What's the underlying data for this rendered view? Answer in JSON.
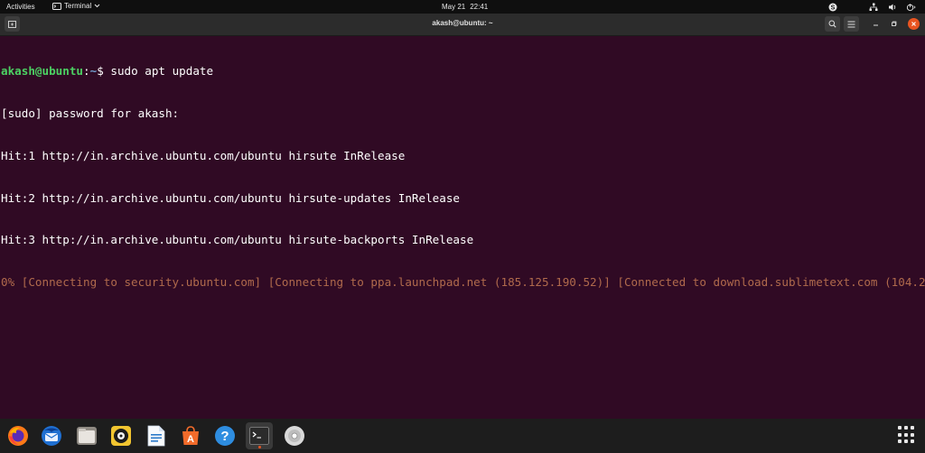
{
  "topbar": {
    "activities": "Activities",
    "app_menu": "Terminal",
    "date": "May 21",
    "time": "22:41"
  },
  "window": {
    "title": "akash@ubuntu: ~"
  },
  "terminal": {
    "prompt_user": "akash@ubuntu",
    "prompt_sep": ":",
    "prompt_path": "~",
    "prompt_dollar": "$ ",
    "command": "sudo apt update",
    "lines": [
      "[sudo] password for akash:",
      "Hit:1 http://in.archive.ubuntu.com/ubuntu hirsute InRelease",
      "Hit:2 http://in.archive.ubuntu.com/ubuntu hirsute-updates InRelease",
      "Hit:3 http://in.archive.ubuntu.com/ubuntu hirsute-backports InRelease"
    ],
    "progress_line": "0% [Connecting to security.ubuntu.com] [Connecting to ppa.launchpad.net (185.125.190.52)] [Connected to download.sublimetext.com (104.2"
  },
  "dock": {
    "apps": [
      "firefox-icon",
      "thunderbird-icon",
      "files-icon",
      "rhythmbox-icon",
      "libreoffice-writer-icon",
      "software-center-icon",
      "help-icon",
      "terminal-icon",
      "disc-icon"
    ]
  },
  "colors": {
    "terminal_bg": "#300a24",
    "prompt_user": "#4cd163",
    "prompt_path": "#729fcf",
    "progress_text": "#b06a4c",
    "accent": "#e95420"
  }
}
